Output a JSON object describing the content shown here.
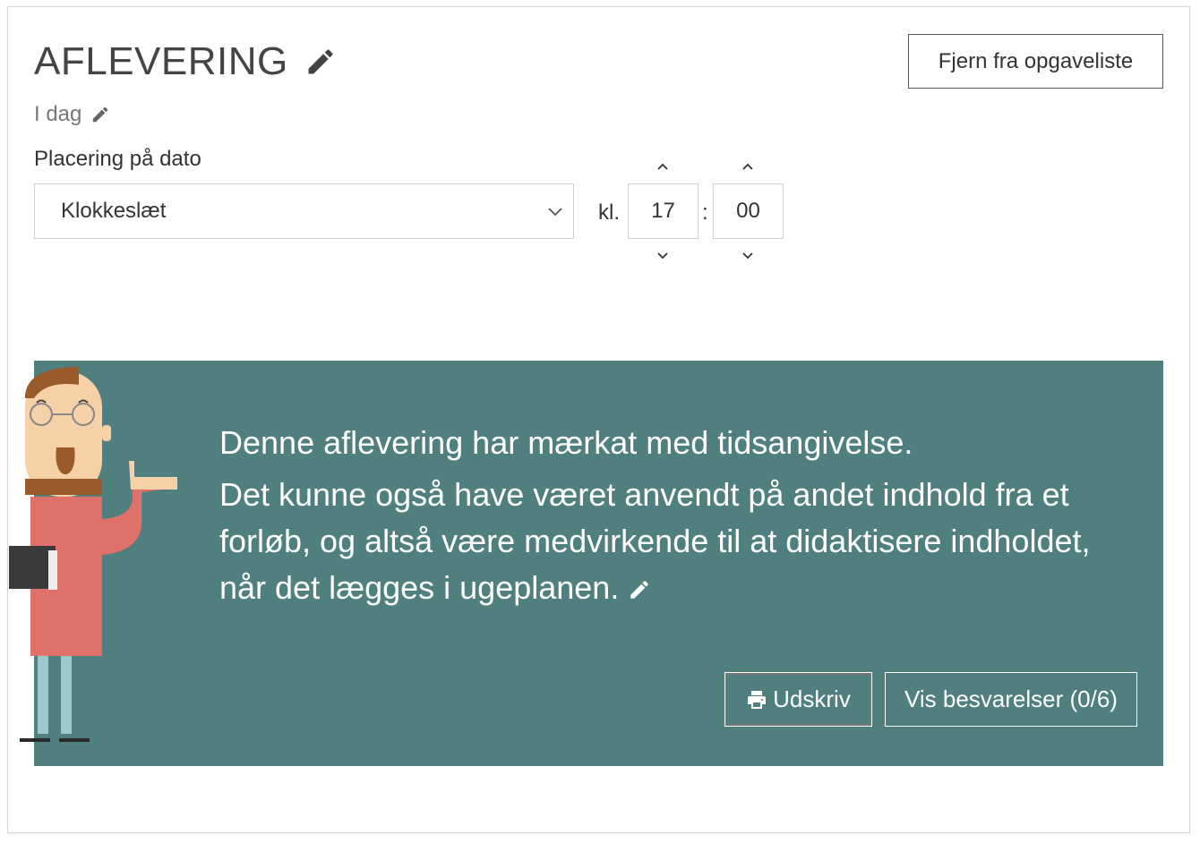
{
  "header": {
    "title": "AFLEVERING",
    "title_edit_icon": "pencil-icon",
    "remove_button_label": "Fjern fra opgaveliste"
  },
  "date": {
    "text": "I dag",
    "edit_icon": "pencil-icon"
  },
  "placement": {
    "label": "Placering på dato",
    "selected": "Klokkeslæt",
    "chevron_icon": "chevron-down-icon"
  },
  "time": {
    "prefix": "kl.",
    "hour": "17",
    "separator": ":",
    "minute": "00"
  },
  "banner": {
    "line1": "Denne aflevering har mærkat med tidsangivelse.",
    "line2": "Det kunne også have været anvendt på andet indhold fra et forløb, og altså være medvirkende til at didaktisere indholdet, når det lægges i ugeplanen.",
    "print_label": "Udskriv",
    "print_icon": "printer-icon",
    "answers_label": "Vis besvarelser (0/6)",
    "background_color": "#4f7f7e"
  }
}
